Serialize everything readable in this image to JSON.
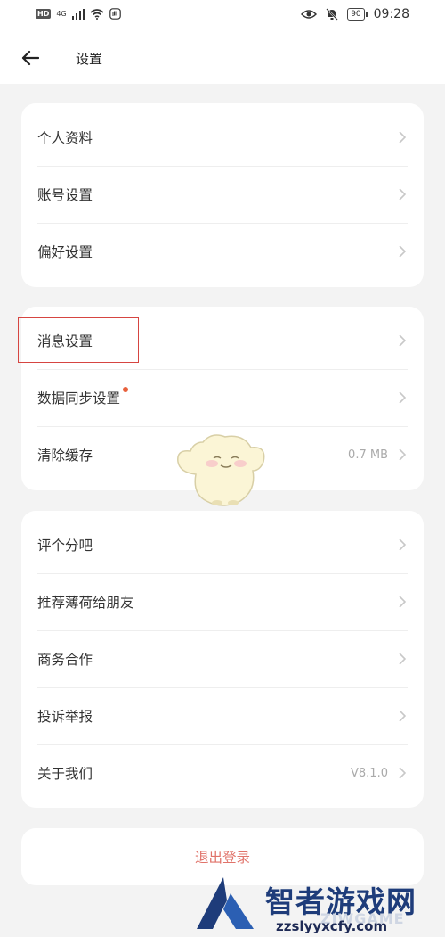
{
  "status_bar": {
    "hd": "HD",
    "net": "4G",
    "battery": "90",
    "time": "09:28"
  },
  "header": {
    "title": "设置"
  },
  "groups": [
    {
      "items": [
        {
          "label": "个人资料",
          "value": ""
        },
        {
          "label": "账号设置",
          "value": ""
        },
        {
          "label": "偏好设置",
          "value": ""
        }
      ]
    },
    {
      "items": [
        {
          "label": "消息设置",
          "value": ""
        },
        {
          "label": "数据同步设置",
          "value": "",
          "dot": true
        },
        {
          "label": "清除缓存",
          "value": "0.7 MB"
        }
      ]
    },
    {
      "items": [
        {
          "label": "评个分吧",
          "value": ""
        },
        {
          "label": "推荐薄荷给朋友",
          "value": ""
        },
        {
          "label": "商务合作",
          "value": ""
        },
        {
          "label": "投诉举报",
          "value": ""
        },
        {
          "label": "关于我们",
          "value": "V8.1.0"
        }
      ]
    }
  ],
  "logout_label": "退出登录",
  "watermark": {
    "name": "智者游戏网",
    "sub": "ZJWGAME",
    "url": "zzslyyxcfy.com"
  },
  "colors": {
    "background": "#f3f3f3",
    "card": "#ffffff",
    "logout_text": "#e0736a",
    "highlight_box": "#d64541",
    "dot": "#e8603c"
  }
}
